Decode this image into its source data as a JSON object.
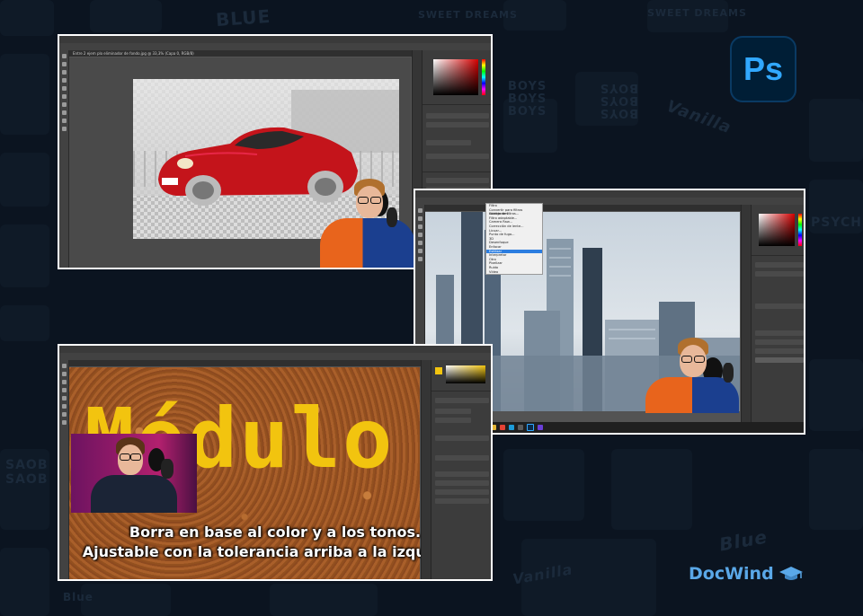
{
  "brand": {
    "ps_logo_text": "Ps",
    "docwind_text": "DocWind",
    "colors": {
      "ps_bg": "#001e36",
      "ps_fg": "#31a8ff",
      "docwind": "#5aa8e8"
    }
  },
  "background_words": [
    "BLUE",
    "SWEET DREAMS",
    "BOYS BOYS BOYS",
    "BOYS BOYS BOYS",
    "PSYCH",
    "Vanilla",
    "Vanilla",
    "Blue",
    "Blue",
    "SWEET DREAMS",
    "SAOB SAOB"
  ],
  "shot1": {
    "doc_tab": "Entre 2 ejem plo eliminador de fondo.jpg @ 33,3% (Capa 0, RGB/8)",
    "layer_name": "Capa 0",
    "panels": [
      "Capas",
      "Canales",
      "Trazados"
    ]
  },
  "shot2": {
    "menu_items": [
      "Filtro",
      "Convertir para filtros inteligentes",
      "Galería de filtros...",
      "Filtro adaptable...",
      "Camera Raw...",
      "Corrección de lente...",
      "Licuar...",
      "Punto de fuga...",
      "3D",
      "Desenfoque",
      "Enfocar",
      "Estilizar",
      "Interpretar",
      "Otro",
      "Pixelizar",
      "Ruido",
      "Vídeo"
    ],
    "selected_item": "Estilizar"
  },
  "shot3": {
    "subtitle_line1": "Borra en base al color y a los tonos.",
    "subtitle_line2": "Ajustable con la tolerancia arriba a la izquierda",
    "poster_text": "Módulo"
  },
  "icons": [
    "photoshop-logo-icon",
    "graduation-cap-icon"
  ]
}
